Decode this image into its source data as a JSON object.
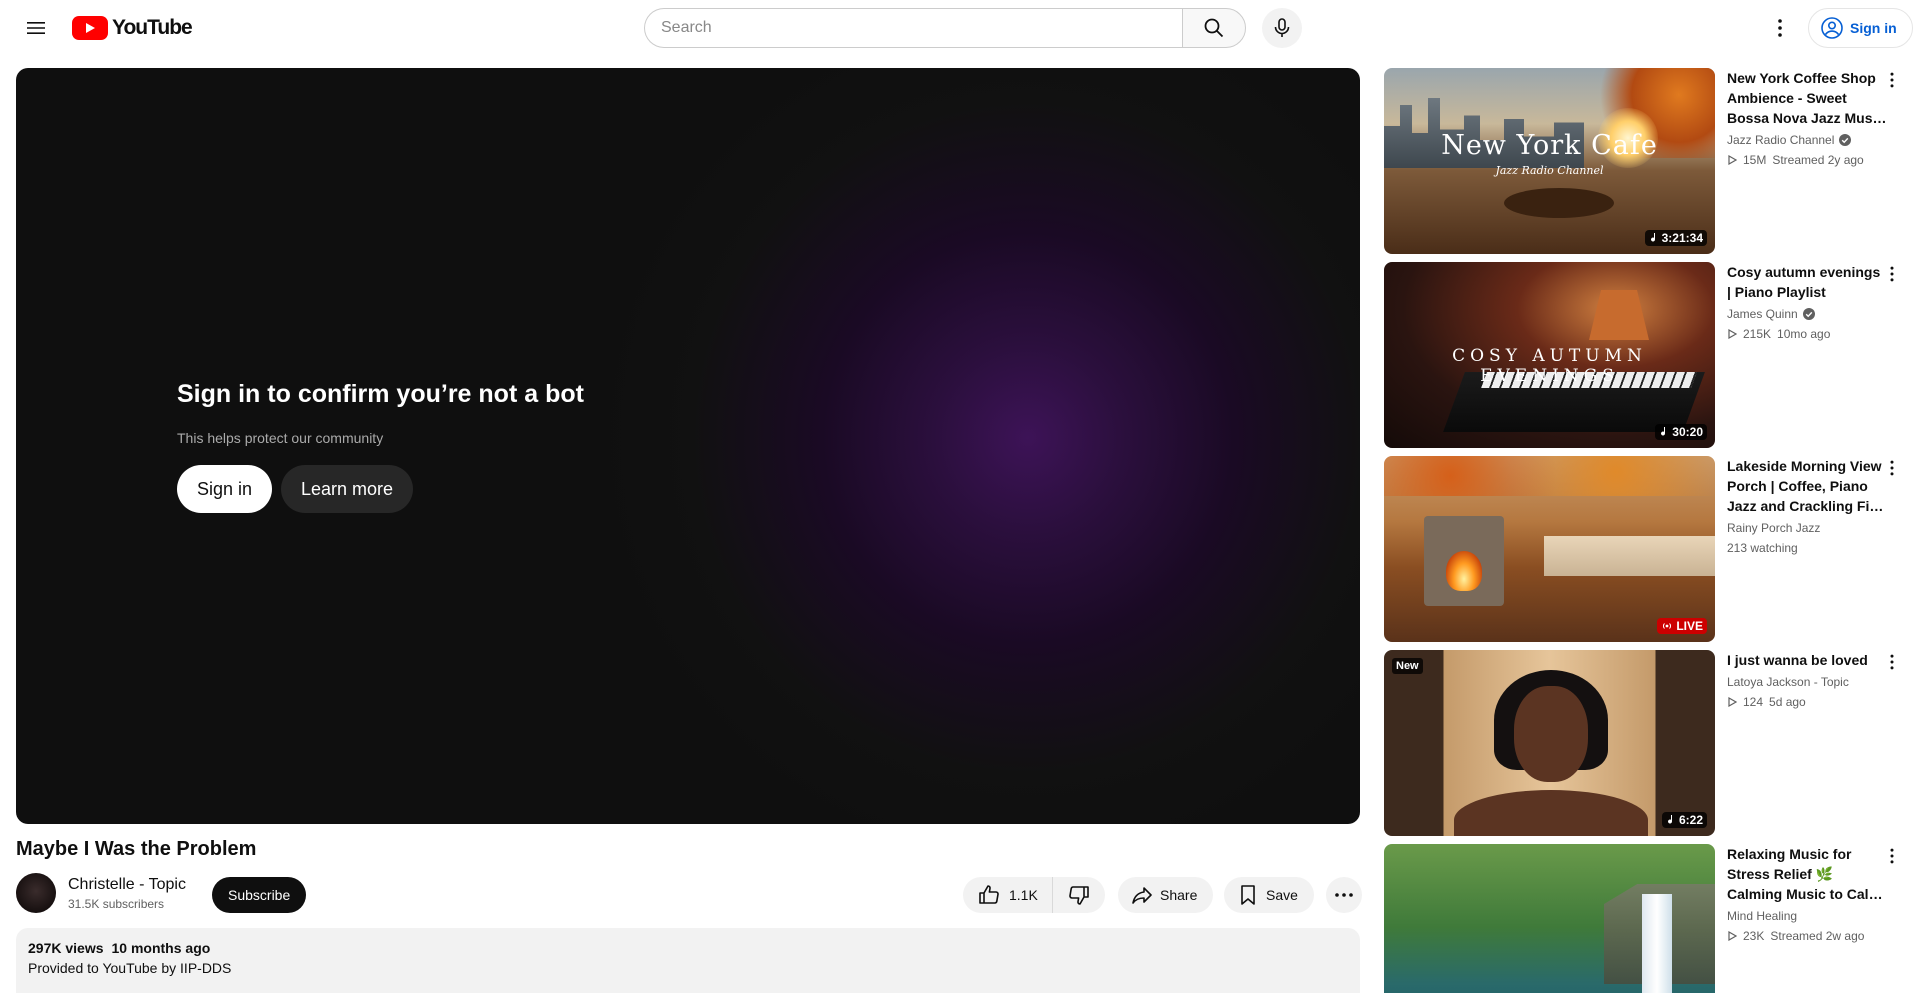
{
  "header": {
    "logo_text": "YouTube",
    "search_placeholder": "Search",
    "sign_in_label": "Sign in"
  },
  "player": {
    "bot_title": "Sign in to confirm you’re not a bot",
    "bot_subtitle": "This helps protect our community",
    "sign_in_label": "Sign in",
    "learn_more_label": "Learn more"
  },
  "video": {
    "title": "Maybe I Was the Problem",
    "channel_name": "Christelle - Topic",
    "subscribers": "31.5K subscribers",
    "subscribe_label": "Subscribe",
    "likes": "1.1K",
    "share_label": "Share",
    "save_label": "Save",
    "views": "297K views",
    "date": "10 months ago",
    "description": "Provided to YouTube by IIP-DDS"
  },
  "recommendations": [
    {
      "title": "New York Coffee Shop Ambience - Sweet Bossa Nova Jazz Music to Work, Study",
      "channel": "Jazz Radio Channel",
      "verified": true,
      "views": "15M",
      "age": "Streamed 2y ago",
      "duration": "3:21:34",
      "thumb_text_main": "New York Cafe",
      "thumb_text_sub": "Jazz Radio Channel"
    },
    {
      "title": "Cosy autumn evenings | Piano Playlist",
      "channel": "James Quinn",
      "verified": true,
      "views": "215K",
      "age": "10mo ago",
      "duration": "30:20",
      "thumb_text_main": "COSY AUTUMN EVENINGS"
    },
    {
      "title": "Lakeside Morning View Porch | Coffee, Piano Jazz and Crackling Fire Ambience",
      "channel": "Rainy Porch Jazz",
      "verified": false,
      "watching": "213 watching",
      "live_label": "LIVE"
    },
    {
      "title": "I just wanna be loved",
      "channel": "Latoya Jackson - Topic",
      "verified": false,
      "views": "124",
      "age": "5d ago",
      "duration": "6:22",
      "badge": "New"
    },
    {
      "title": "Relaxing Music for Stress Relief 🌿 Calming Music to Calm the Mind, Heal the Soul",
      "channel": "Mind Healing",
      "verified": false,
      "views": "23K",
      "age": "Streamed 2w ago"
    }
  ]
}
